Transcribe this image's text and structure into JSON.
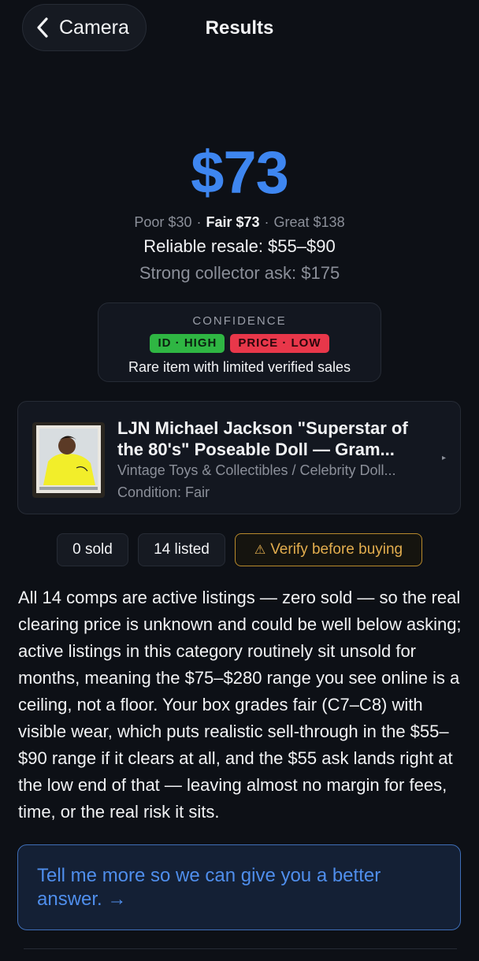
{
  "header": {
    "back_label": "Camera",
    "title": "Results"
  },
  "valuation": {
    "price": "$73",
    "poor": "Poor $30",
    "fair": "Fair $73",
    "great": "Great $138",
    "separator": "·",
    "reliable_resale": "Reliable resale: $55–$90",
    "collector_ask": "Strong collector ask: $175"
  },
  "confidence": {
    "title": "CONFIDENCE",
    "id_badge": "ID · HIGH",
    "price_badge": "PRICE · LOW",
    "note": "Rare item with limited verified sales",
    "colors": {
      "high": "#2fb643",
      "low": "#e8374a"
    }
  },
  "item": {
    "title": "LJN Michael Jackson \"Superstar of the 80's\" Poseable Doll — Gram...",
    "category": "Vintage Toys & Collectibles / Celebrity Doll...",
    "condition": "Condition: Fair",
    "chevron": "▸"
  },
  "chips": {
    "sold": "0 sold",
    "listed": "14 listed",
    "warning": "Verify before buying",
    "warning_icon": "warning-triangle-icon"
  },
  "analysis": "All 14 comps are active listings — zero sold — so the real clearing price is unknown and could be well below asking; active listings in this category routinely sit unsold for months, meaning the $75–$280 range you see online is a ceiling, not a floor. Your box grades fair (C7–C8) with visible wear, which puts realistic sell-through in the $55–$90 range if it clears at all, and the $55 ask lands right at the low end of that — leaving almost no margin for fees, time, or the real risk it sits.",
  "cta": {
    "text": "Tell me more so we can give you a better answer. →"
  },
  "colors": {
    "background": "#0d1016",
    "accent": "#3e86f0",
    "warning": "#e2ad4e"
  }
}
